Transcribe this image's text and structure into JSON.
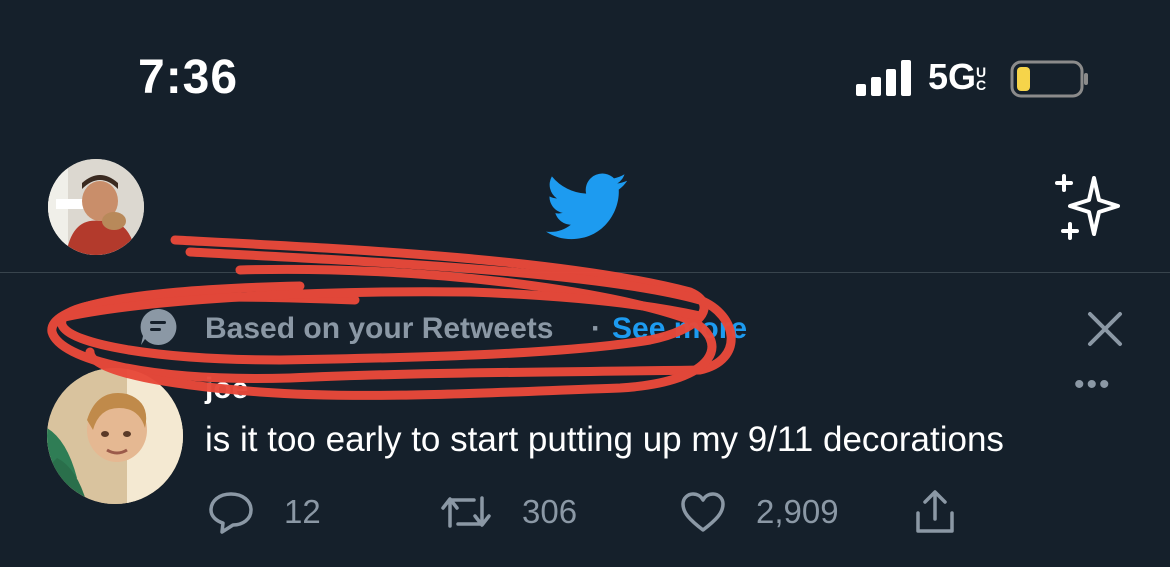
{
  "status_bar": {
    "time": "7:36",
    "network": "5G",
    "network_suffix": "UC",
    "battery_color": "#f6d44a"
  },
  "header": {
    "logo_icon": "twitter-bird-icon",
    "logo_color": "#1d9bf0",
    "sparkle_icon": "sparkle-icon"
  },
  "context": {
    "label": "Based on your Retweets",
    "separator": "·",
    "link": "See more"
  },
  "tweet": {
    "author": "joe",
    "text": "is it too early to start putting up my 9/11 decorations",
    "more_icon": "•••",
    "replies": "12",
    "retweets": "306",
    "likes": "2,909"
  },
  "colors": {
    "background": "#15202b",
    "muted": "#8b98a5",
    "accent": "#1d9bf0",
    "scribble": "#e8493a"
  }
}
